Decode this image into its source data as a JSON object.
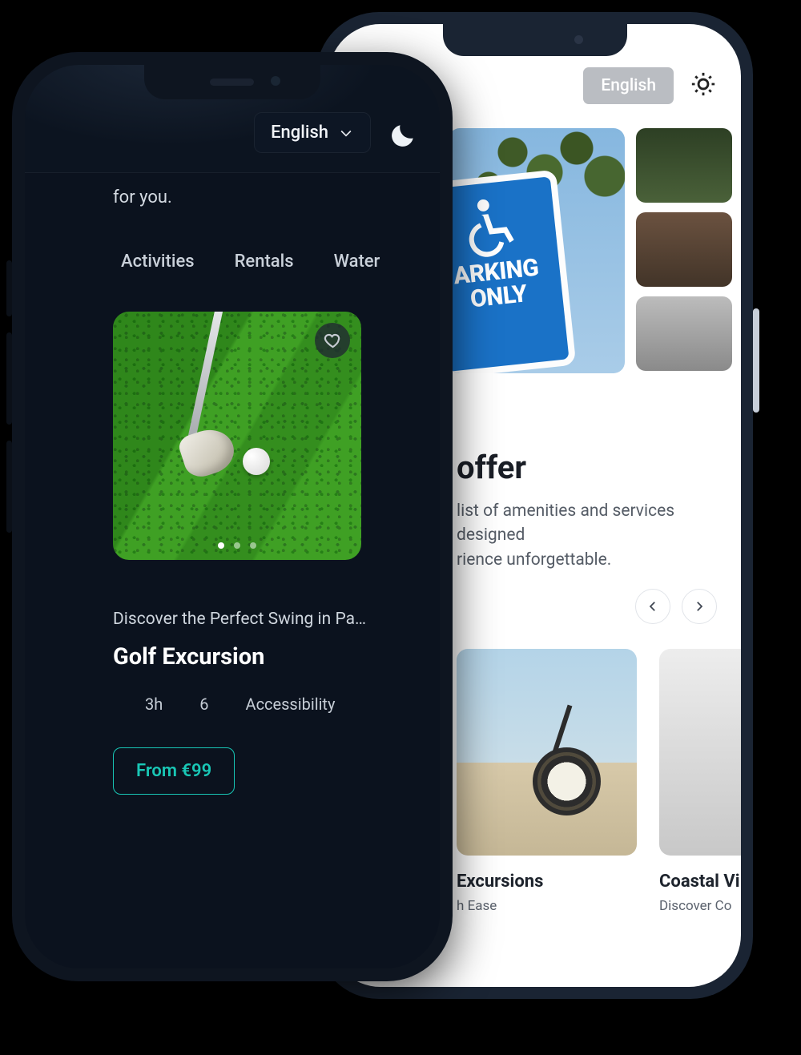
{
  "light": {
    "language": "English",
    "sign": {
      "line1": "ARKING",
      "line2": "ONLY"
    },
    "offer": {
      "title_fragment": "offer",
      "text_a": "list of amenities and services designed",
      "text_b": "rience unforgettable."
    },
    "cards": [
      {
        "title_fragment": "Excursions",
        "subtitle_fragment": "h Ease"
      },
      {
        "title_fragment": "Coastal Vil",
        "subtitle_fragment": "Discover Co"
      }
    ]
  },
  "dark": {
    "language": "English",
    "tail_text": "for you.",
    "tabs": [
      "Activities",
      "Rentals",
      "Water"
    ],
    "card": {
      "tagline": "Discover the Perfect Swing in Para…",
      "title": "Golf Excursion",
      "duration": "3h",
      "capacity": "6",
      "access": "Accessibility",
      "price_label": "From €99"
    }
  }
}
